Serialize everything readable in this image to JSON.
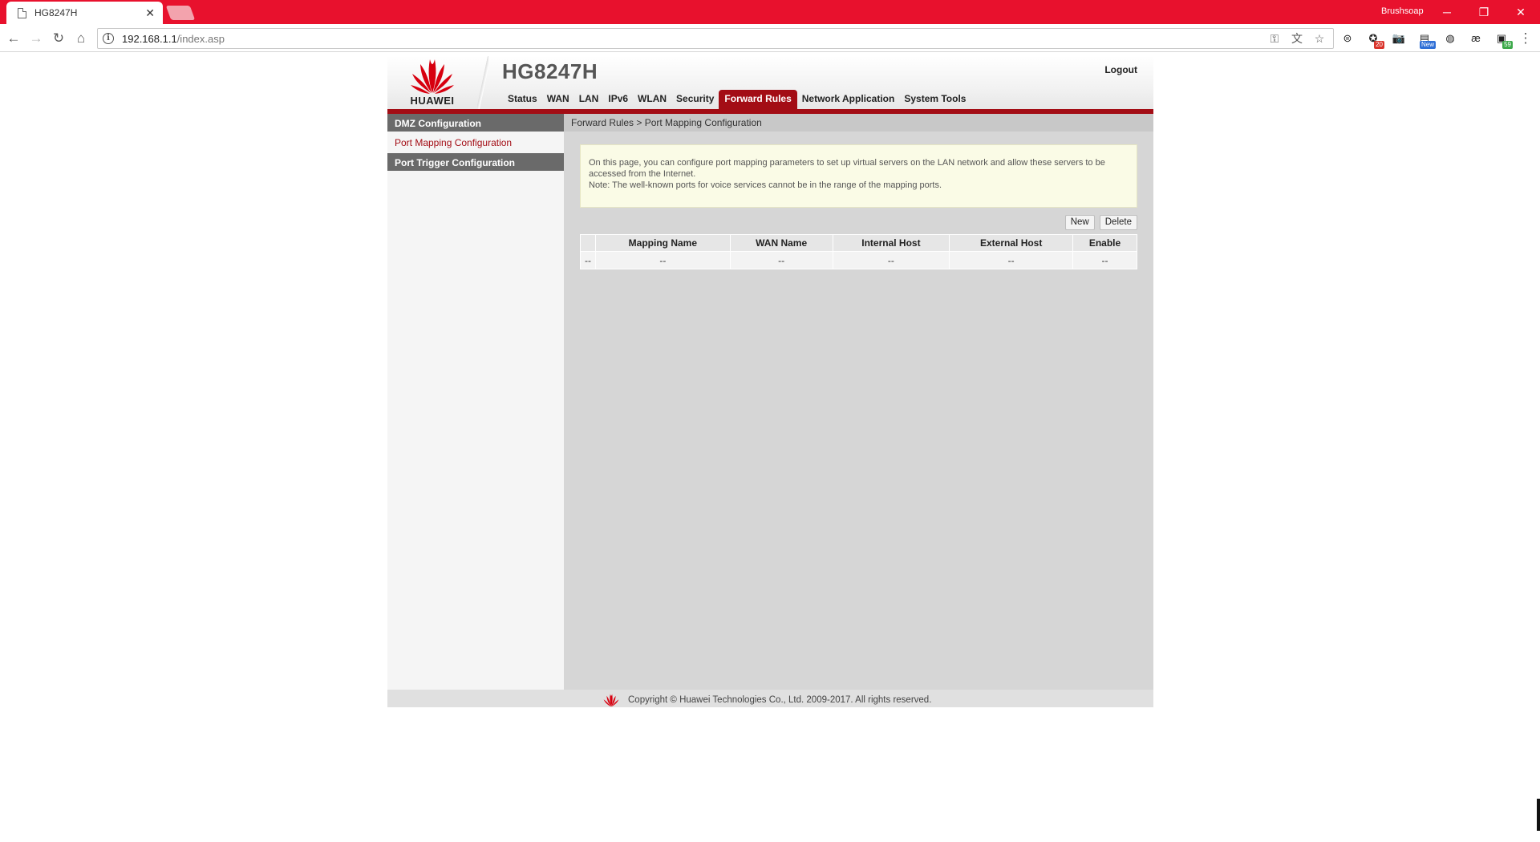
{
  "browser": {
    "tab_title": "HG8247H",
    "tab_close": "✕",
    "profile": "Brushsoap",
    "window_controls": {
      "minimize": "─",
      "restore": "❐",
      "close": "✕"
    },
    "url_host": "192.168.1.1",
    "url_path": "/index.asp",
    "extensions": [
      {
        "name": "e-icon",
        "glyph": "⊜"
      },
      {
        "name": "chrome-extension-20-icon",
        "glyph": "✪",
        "badge": "20",
        "badge_color": "#d9342b"
      },
      {
        "name": "camera-icon",
        "glyph": "📷"
      },
      {
        "name": "news-extension-icon",
        "glyph": "▤",
        "badge": "New",
        "badge_color": "#2f6fd6"
      },
      {
        "name": "orange-extension-icon",
        "glyph": "◍"
      },
      {
        "name": "ae-extension-icon",
        "glyph": "æ"
      },
      {
        "name": "green-extension-59-icon",
        "glyph": "▣",
        "badge": "59",
        "badge_color": "#3ea94b"
      }
    ]
  },
  "router": {
    "brand": "HUAWEI",
    "model": "HG8247H",
    "logout": "Logout",
    "nav": [
      "Status",
      "WAN",
      "LAN",
      "IPv6",
      "WLAN",
      "Security",
      "Forward Rules",
      "Network Application",
      "System Tools"
    ],
    "active_nav": "Forward Rules",
    "sidebar": {
      "dmz": "DMZ Configuration",
      "port_mapping": "Port Mapping Configuration",
      "port_trigger": "Port Trigger Configuration"
    },
    "breadcrumb": "Forward Rules > Port Mapping Configuration",
    "notice_line1": "On this page, you can configure port mapping parameters to set up virtual servers on the LAN network and allow these servers to be accessed from the Internet.",
    "notice_line2": "Note: The well-known ports for voice services cannot be in the range of the mapping ports.",
    "buttons": {
      "new": "New",
      "delete": "Delete"
    },
    "table": {
      "headers": [
        "",
        "Mapping Name",
        "WAN Name",
        "Internal Host",
        "External Host",
        "Enable"
      ],
      "row": [
        "--",
        "--",
        "--",
        "--",
        "--",
        "--"
      ]
    },
    "footer": "Copyright © Huawei Technologies Co., Ltd. 2009-2017. All rights reserved.",
    "colors": {
      "brand_red": "#a30d15",
      "chrome_red": "#e8112d",
      "sidebar_dark": "#6a6a6a"
    }
  }
}
